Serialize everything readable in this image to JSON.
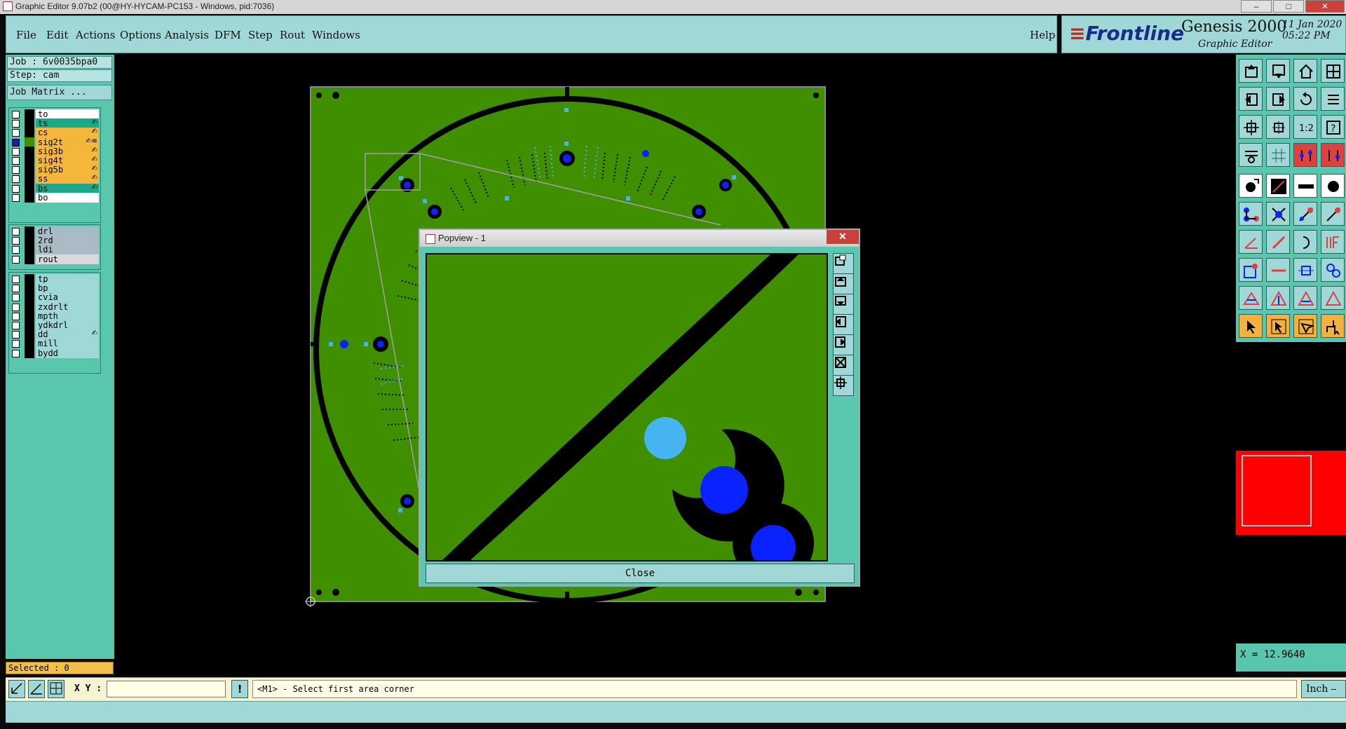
{
  "window": {
    "title": "Graphic Editor 9.07b2 (00@HY-HYCAM-PC153 - Windows, pid:7036)",
    "minimize": "–",
    "maximize": "□",
    "close": "✕"
  },
  "menu": {
    "items": [
      "File",
      "Edit",
      "Actions",
      "Options",
      "Analysis",
      "DFM",
      "Step",
      "Rout",
      "Windows"
    ],
    "help": "Help"
  },
  "brand": {
    "logo": "Frontline",
    "product": "Genesis 2000",
    "module": "Graphic Editor",
    "date": "11 Jan 2020",
    "time": "05:22 PM"
  },
  "job": {
    "job_label": "Job : 6v0035bpa0",
    "step_label": "Step: cam",
    "matrix_button": "Job Matrix ..."
  },
  "layers": {
    "board": [
      {
        "name": "to",
        "color": "#ffffff",
        "checked": false,
        "icon": ""
      },
      {
        "name": "ts",
        "color": "#1ea88a",
        "checked": false,
        "icon": "✍"
      },
      {
        "name": "cs",
        "color": "#f5b63c",
        "checked": false,
        "icon": "✍"
      },
      {
        "name": "sig2t",
        "color": "#f5b63c",
        "checked": true,
        "icon": "✍≡"
      },
      {
        "name": "sig3b",
        "color": "#f5b63c",
        "checked": false,
        "icon": "✍"
      },
      {
        "name": "sig4t",
        "color": "#f5b63c",
        "checked": false,
        "icon": "✍"
      },
      {
        "name": "sig5b",
        "color": "#f5b63c",
        "checked": false,
        "icon": "✍"
      },
      {
        "name": "ss",
        "color": "#f5b63c",
        "checked": false,
        "icon": "✍"
      },
      {
        "name": "bs",
        "color": "#1ea88a",
        "checked": false,
        "icon": "✍"
      },
      {
        "name": "bo",
        "color": "#ffffff",
        "checked": false,
        "icon": ""
      }
    ],
    "drill": [
      {
        "name": "drl",
        "color": "#a9bcc6",
        "checked": false,
        "icon": ""
      },
      {
        "name": "2rd",
        "color": "#a9bcc6",
        "checked": false,
        "icon": ""
      },
      {
        "name": "ldi",
        "color": "#a9bcc6",
        "checked": false,
        "icon": ""
      },
      {
        "name": "rout",
        "color": "#d9d9d9",
        "checked": false,
        "icon": ""
      }
    ],
    "misc": [
      {
        "name": "tp",
        "color": "#9fd8d6",
        "checked": false,
        "icon": ""
      },
      {
        "name": "bp",
        "color": "#9fd8d6",
        "checked": false,
        "icon": ""
      },
      {
        "name": "cvia",
        "color": "#9fd8d6",
        "checked": false,
        "icon": ""
      },
      {
        "name": "zxdrlt",
        "color": "#9fd8d6",
        "checked": false,
        "icon": ""
      },
      {
        "name": "mpth",
        "color": "#9fd8d6",
        "checked": false,
        "icon": ""
      },
      {
        "name": "ydkdrl",
        "color": "#9fd8d6",
        "checked": false,
        "icon": ""
      },
      {
        "name": "dd",
        "color": "#9fd8d6",
        "checked": false,
        "icon": "✍"
      },
      {
        "name": "mill",
        "color": "#9fd8d6",
        "checked": false,
        "icon": ""
      },
      {
        "name": "bydd",
        "color": "#9fd8d6",
        "checked": false,
        "icon": ""
      }
    ]
  },
  "selected_label": "Selected : 0",
  "popview": {
    "title": "Popview - 1",
    "close_x": "✕",
    "close_button": "Close"
  },
  "coords": {
    "x_readout": "X = 12.9640"
  },
  "status": {
    "xy_label": "X Y :",
    "xy_value": "",
    "exclaim": "!",
    "prompt": "<M1> - Select first area corner",
    "units": "Inch"
  },
  "colors": {
    "board_green": "#3f8f00",
    "pad_blue": "#0a22ff",
    "pad_cyan": "#46b4f0",
    "panel_teal": "#59c6ae",
    "button_face": "#9fd8d6"
  }
}
